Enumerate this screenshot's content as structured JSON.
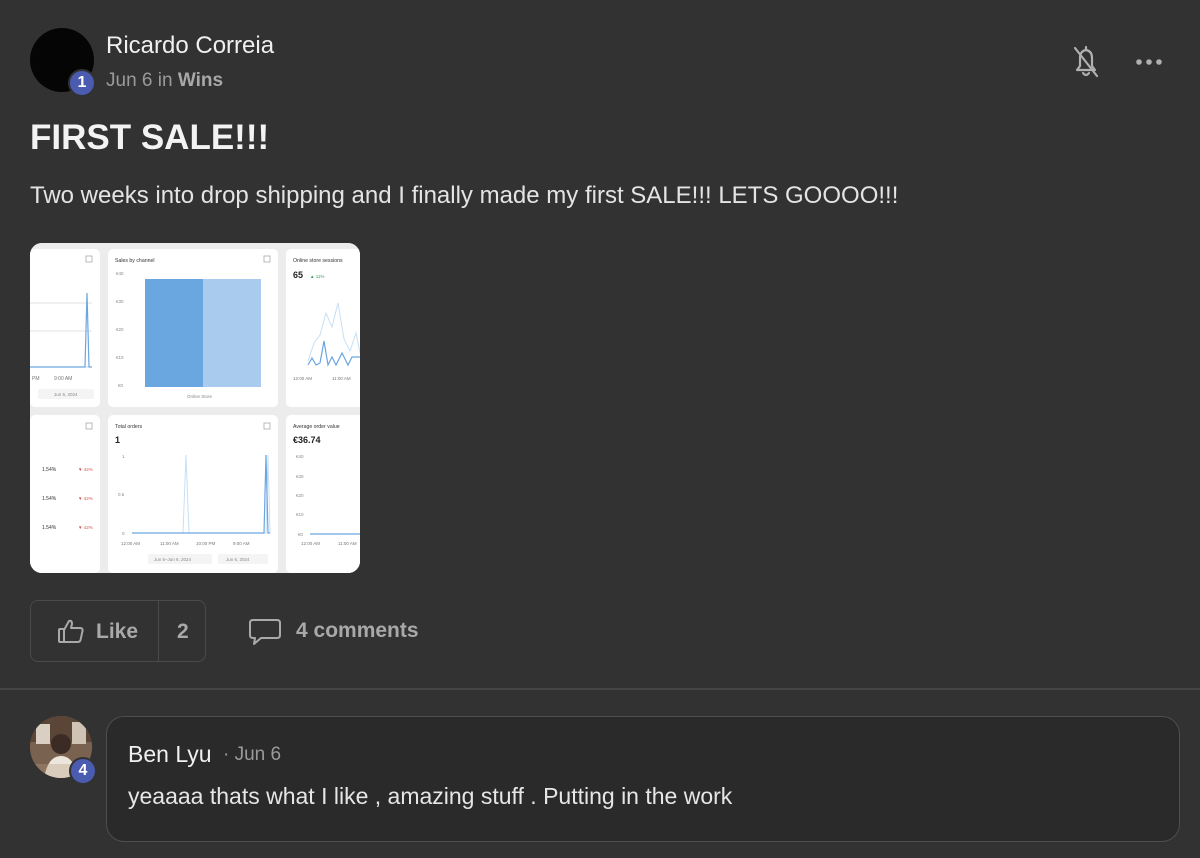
{
  "post": {
    "author": "Ricardo Correia",
    "level": "1",
    "date": "Jun 6",
    "in_word": "in",
    "category": "Wins",
    "title": "FIRST SALE!!!",
    "body": "Two weeks into drop shipping and I finally made my first SALE!!! LETS GOOOO!!!",
    "like_label": "Like",
    "like_count": "2",
    "comments_label": "4 comments"
  },
  "attachment": {
    "sales_by_channel": "Sales by channel",
    "sessions_title": "Online store sessions",
    "sessions_value": "65",
    "total_orders": "Total orders",
    "total_orders_value": "1",
    "aov_title": "Average order value",
    "aov_value": "€36.74",
    "online_store": "Online Store",
    "date_label": "Jun 6, 2024",
    "range_label": "Jun 5–Jun 6, 2024",
    "rate": "1.54%"
  },
  "comment": {
    "author": "Ben Lyu",
    "date": "· Jun 6",
    "level": "4",
    "text": "yeaaaa thats what I like , amazing stuff . Putting in the work"
  },
  "icons": {
    "bell": "bell-off-icon",
    "more": "more-horizontal-icon",
    "like": "thumbs-up-icon",
    "comment": "speech-bubble-icon"
  },
  "colors": {
    "background": "#323232",
    "badge": "#4a5bb0",
    "chart_blue": "#6aa6e0"
  }
}
